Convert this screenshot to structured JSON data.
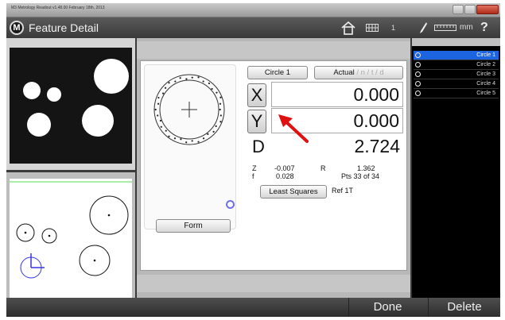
{
  "window": {
    "title": "M3 Metrology Readout  v1.48.00  February 18th, 2013"
  },
  "appbar": {
    "logo_letter": "M",
    "title": "Feature Detail",
    "page_number": "1",
    "units": "mm",
    "help": "?",
    "icons": [
      "home-icon",
      "grid-icon",
      "probe-icon",
      "ruler-icon",
      "help-icon"
    ]
  },
  "feature": {
    "name": "Circle 1",
    "mode_label": "Actual",
    "mode_options": "/ n / t / d"
  },
  "measurements": {
    "x_label": "X",
    "x_value": "0.000",
    "y_label": "Y",
    "y_value": "0.000",
    "d_label": "D",
    "d_value": "2.724"
  },
  "stats": {
    "z_label": "Z",
    "z_value": "-0.007",
    "r_label": "R",
    "r_value": "1.362",
    "f_label": "f",
    "f_value": "0.028",
    "pts_text": "Pts 33 of 34"
  },
  "fit": {
    "method": "Least Squares",
    "reference": "Ref 1T"
  },
  "form_button": "Form",
  "feature_list": [
    {
      "name": "Circle 1",
      "selected": true
    },
    {
      "name": "Circle 2",
      "selected": false
    },
    {
      "name": "Circle 3",
      "selected": false
    },
    {
      "name": "Circle 4",
      "selected": false
    },
    {
      "name": "Circle 5",
      "selected": false
    }
  ],
  "footer": {
    "done": "Done",
    "delete": "Delete"
  },
  "colors": {
    "selection": "#1c64e0",
    "arrow": "#e01010",
    "status_ring": "#6f6ff0"
  }
}
